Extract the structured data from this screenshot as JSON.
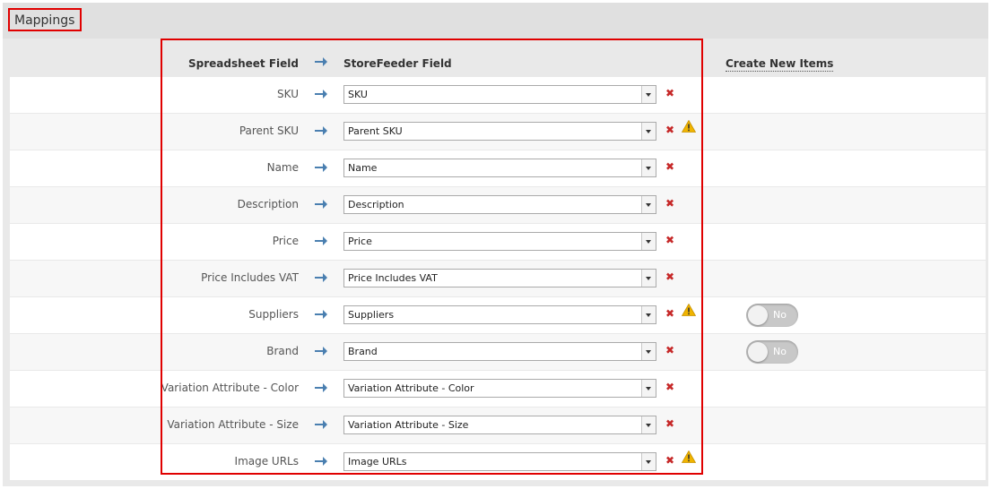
{
  "panel": {
    "title": "Mappings"
  },
  "headers": {
    "spreadsheet_field": "Spreadsheet Field",
    "storefeeder_field": "StoreFeeder Field",
    "create_new_items": "Create New Items"
  },
  "colors": {
    "accent": "#4a7fb0",
    "remove": "#c62828",
    "warning": "#f0b400",
    "highlight": "#e00000"
  },
  "rows": [
    {
      "label": "SKU",
      "value": "SKU",
      "warning": false,
      "toggle": null
    },
    {
      "label": "Parent SKU",
      "value": "Parent SKU",
      "warning": true,
      "toggle": null
    },
    {
      "label": "Name",
      "value": "Name",
      "warning": false,
      "toggle": null
    },
    {
      "label": "Description",
      "value": "Description",
      "warning": false,
      "toggle": null
    },
    {
      "label": "Price",
      "value": "Price",
      "warning": false,
      "toggle": null
    },
    {
      "label": "Price Includes VAT",
      "value": "Price Includes VAT",
      "warning": false,
      "toggle": null
    },
    {
      "label": "Suppliers",
      "value": "Suppliers",
      "warning": true,
      "toggle": "No"
    },
    {
      "label": "Brand",
      "value": "Brand",
      "warning": false,
      "toggle": "No"
    },
    {
      "label": "Variation Attribute - Color",
      "value": "Variation Attribute - Color",
      "warning": false,
      "toggle": null
    },
    {
      "label": "Variation Attribute - Size",
      "value": "Variation Attribute - Size",
      "warning": false,
      "toggle": null
    },
    {
      "label": "Image URLs",
      "value": "Image URLs",
      "warning": true,
      "toggle": null
    }
  ]
}
